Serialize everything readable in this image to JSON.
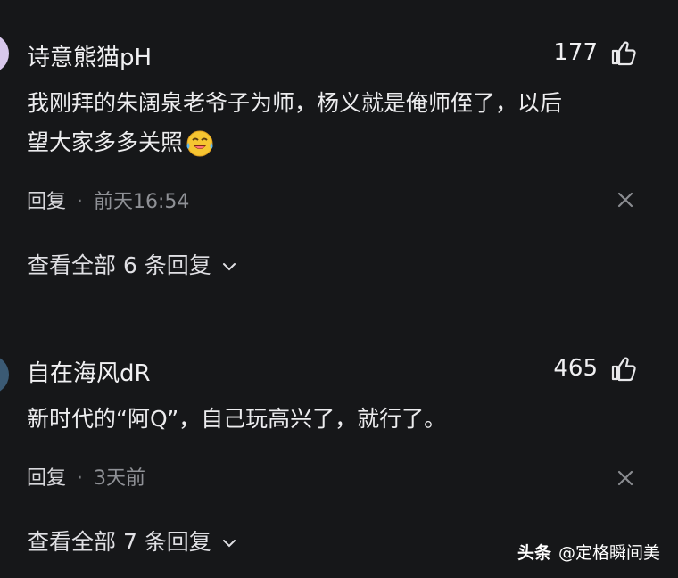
{
  "comments": [
    {
      "username": "诗意熊猫pH",
      "likes": "177",
      "text_line1": "我刚拜的朱阔泉老爷子为师，杨义就是俺师侄了，以后",
      "text_line2": "望大家多多关照",
      "emoji": "laughing-crying-emoji",
      "reply_label": "回复",
      "separator": "·",
      "time": "前天16:54",
      "view_replies": "查看全部 6 条回复"
    },
    {
      "username": "自在海风dR",
      "likes": "465",
      "text_line1": "新时代的“阿Q”，自己玩高兴了，就行了。",
      "reply_label": "回复",
      "separator": "·",
      "time": "3天前",
      "view_replies": "查看全部 7 条回复"
    }
  ],
  "watermark": {
    "brand": "头条",
    "handle": "@定格瞬间美"
  },
  "colors": {
    "background": "#161719",
    "text": "#ececee",
    "meta": "#8f9196"
  }
}
